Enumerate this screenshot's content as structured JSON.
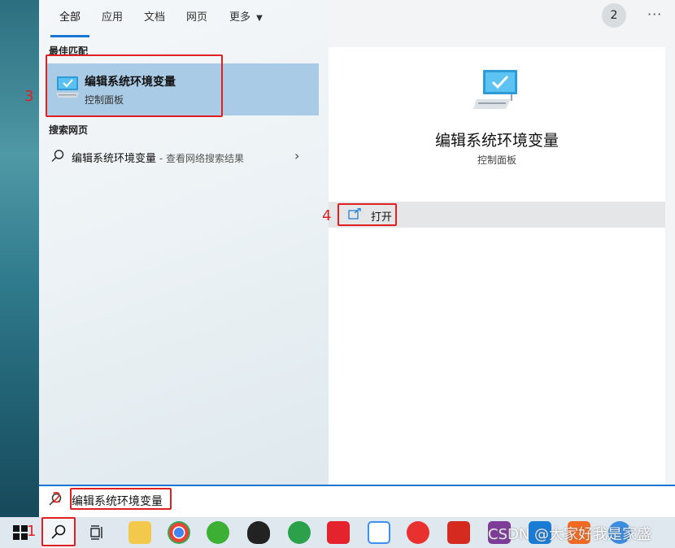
{
  "tabs": [
    {
      "label": "全部",
      "active": true
    },
    {
      "label": "应用"
    },
    {
      "label": "文档"
    },
    {
      "label": "网页"
    },
    {
      "label": "更多"
    }
  ],
  "header": {
    "badge_count": "2",
    "more_icon": "ellipsis-icon",
    "close_icon": "close-icon"
  },
  "sections": {
    "best_match": "最佳匹配",
    "search_web": "搜索网页"
  },
  "best_match_item": {
    "title": "编辑系统环境变量",
    "subtitle": "控制面板"
  },
  "web_result": {
    "query": "编辑系统环境变量",
    "suffix": " - 查看网络搜索结果"
  },
  "detail": {
    "title": "编辑系统环境变量",
    "subtitle": "控制面板",
    "open_label": "打开"
  },
  "search": {
    "query": "编辑系统环境变量"
  },
  "annotations": {
    "step1": "1",
    "step2": "2",
    "step3": "3",
    "step4": "4"
  },
  "watermark": "CSDN @大家好我是家盛",
  "colors": {
    "accent": "#1976d2",
    "selected": "#a9cbe5",
    "annotation": "#e02020"
  }
}
